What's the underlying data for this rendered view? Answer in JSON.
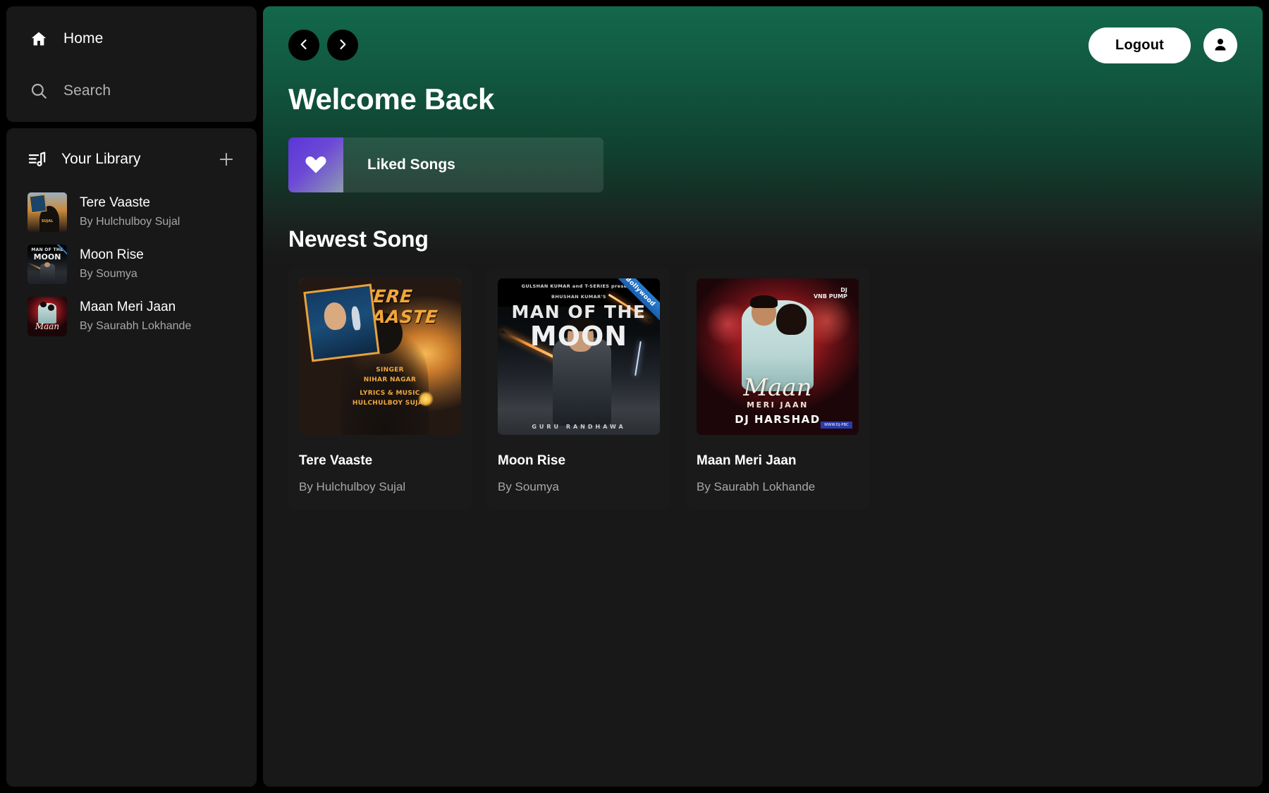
{
  "sidebar": {
    "nav": [
      {
        "label": "Home",
        "icon": "home-icon"
      },
      {
        "label": "Search",
        "icon": "search-icon"
      }
    ],
    "library": {
      "title": "Your Library",
      "icon": "library-icon",
      "add_label": "+",
      "items": [
        {
          "title": "Tere Vaaste",
          "artist": "By Hulchulboy Sujal",
          "art": "tere-vaaste-cover"
        },
        {
          "title": "Moon Rise",
          "artist": "By Soumya",
          "art": "moon-rise-cover"
        },
        {
          "title": "Maan Meri Jaan",
          "artist": "By Saurabh Lokhande",
          "art": "maan-meri-jaan-cover"
        }
      ]
    }
  },
  "header": {
    "back_icon": "chevron-left-icon",
    "forward_icon": "chevron-right-icon",
    "logout_label": "Logout",
    "avatar_icon": "user-icon"
  },
  "main": {
    "welcome_title": "Welcome Back",
    "liked_songs": {
      "label": "Liked Songs",
      "icon": "heart-icon"
    },
    "section_title": "Newest Song",
    "songs": [
      {
        "title": "Tere Vaaste",
        "artist": "By Hulchulboy Sujal",
        "cover": {
          "id": "tere-vaaste-cover",
          "headline": "TERE VAASTE",
          "credit_singer": "SINGER\nNIHAR NAGAR",
          "credit_music": "LYRICS & MUSIC\nHULCHULBOY SUJAL"
        }
      },
      {
        "title": "Moon Rise",
        "artist": "By Soumya",
        "cover": {
          "id": "moon-rise-cover",
          "presents": "GULSHAN KUMAR and T-SERIES presents",
          "presents2": "BHUSHAN KUMAR'S",
          "line1": "MAN OF THE",
          "line2": "MOON",
          "artist_credit": "GURU RANDHAWA",
          "ribbon": "Bollywood"
        }
      },
      {
        "title": "Maan Meri Jaan",
        "artist": "By Saurabh Lokhande",
        "cover": {
          "id": "maan-meri-jaan-cover",
          "title": "Maan",
          "subtitle": "MERI JAAN",
          "dj": "DJ HARSHAD",
          "logo": "DJ\nVNB PUMP",
          "tag": "WWW.DJ-PBC_DB.COM.NEW"
        }
      }
    ]
  },
  "colors": {
    "page_bg": "#000000",
    "panel_bg": "#181818",
    "header_green": "#13684c",
    "accent_white": "#ffffff",
    "muted_text": "#a7a7a7",
    "liked_gradient_start": "#5a36d9",
    "liked_gradient_end": "#8e9bb0"
  }
}
